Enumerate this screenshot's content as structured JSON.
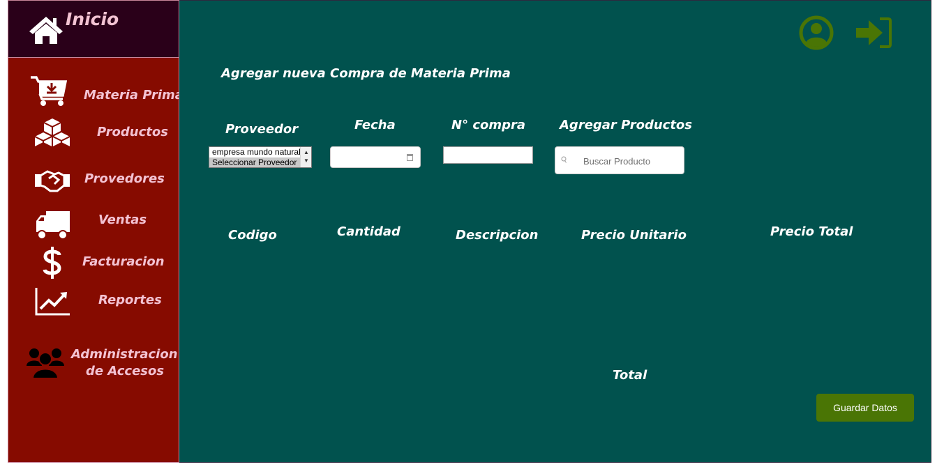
{
  "sidebar": {
    "home_label": "Inicio",
    "items": [
      {
        "label": "Materia Prima",
        "icon": "cart-download-icon"
      },
      {
        "label": "Productos",
        "icon": "boxes-icon"
      },
      {
        "label": "Provedores",
        "icon": "handshake-icon"
      },
      {
        "label": "Ventas",
        "icon": "truck-icon"
      },
      {
        "label": "Facturacion",
        "icon": "dollar-icon"
      },
      {
        "label": "Reportes",
        "icon": "chart-line-icon"
      },
      {
        "label": "Administracion de Accesos",
        "line1": "Administracion",
        "line2": "de Accesos",
        "icon": "users-icon"
      }
    ]
  },
  "header": {
    "user_icon": "user-circle-icon",
    "logout_icon": "sign-in-icon"
  },
  "form": {
    "title": "Agregar nueva Compra de Materia Prima",
    "proveedor_label": "Proveedor",
    "fecha_label": "Fecha",
    "compra_label": "N° compra",
    "agregar_label": "Agregar Productos",
    "proveedor_options": [
      "empresa mundo natural",
      "Seleccionar Proveedor"
    ],
    "proveedor_selected": "Seleccionar Proveedor",
    "fecha_value": "",
    "compra_value": "",
    "search_placeholder": "Buscar Producto"
  },
  "table": {
    "columns": [
      "Codigo",
      "Cantidad",
      "Descripcion",
      "Precio Unitario",
      "Precio Total"
    ],
    "rows": []
  },
  "footer": {
    "total_label": "Total",
    "save_label": "Guardar Datos"
  },
  "colors": {
    "sidebar_bg": "#860b00",
    "sidebar_home_bg": "#2a0019",
    "sidebar_text": "#f3c3d3",
    "main_bg": "#01524e",
    "accent_green": "#4a7505"
  }
}
